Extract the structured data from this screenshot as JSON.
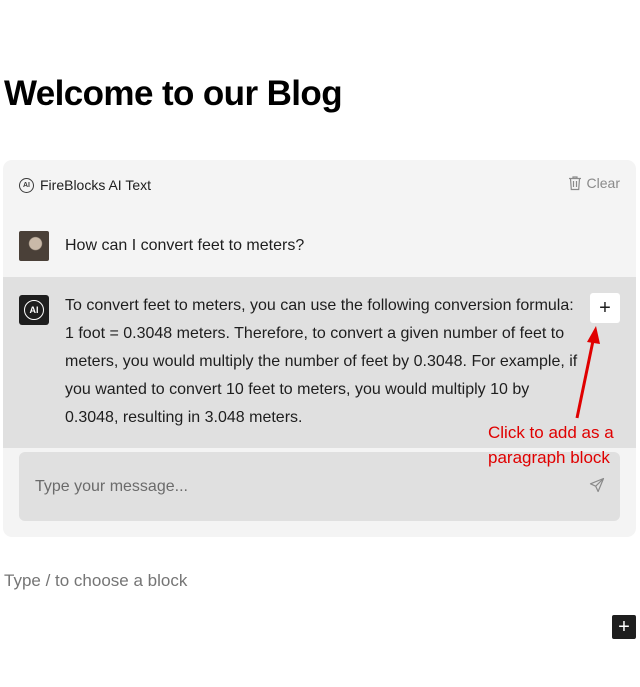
{
  "page": {
    "title": "Welcome to our Blog",
    "block_hint": "Type / to choose a block"
  },
  "panel": {
    "title": "FireBlocks AI Text",
    "ai_badge": "AI",
    "clear_label": "Clear",
    "clear_icon": "trash-icon"
  },
  "conversation": {
    "user_message": "How can I convert feet to meters?",
    "ai_message": "To convert feet to meters, you can use the following conversion formula: 1 foot = 0.3048 meters. Therefore, to convert a given number of feet to meters, you would multiply the number of feet by 0.3048. For example, if you wanted to convert 10 feet to meters, you would multiply 10 by 0.3048, resulting in 3.048 meters.",
    "add_button_label": "+"
  },
  "annotation": {
    "text": "Click to add as a paragraph block",
    "color": "#e00000"
  },
  "composer": {
    "placeholder": "Type your message...",
    "send_icon": "send-icon"
  },
  "inserter": {
    "label": "+"
  },
  "colors": {
    "panel_bg": "#f4f4f4",
    "ai_row_bg": "#e0e0e0",
    "dark": "#1e1e1e"
  }
}
